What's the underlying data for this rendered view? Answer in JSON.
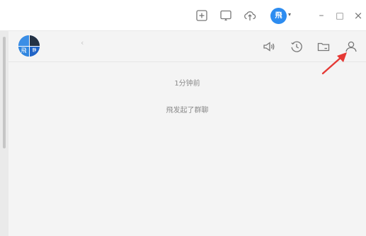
{
  "titlebar": {
    "icons": [
      "add-square-icon",
      "screen-share-icon",
      "cloud-upload-icon"
    ],
    "user_avatar_text": "飛",
    "caret": "▾",
    "minimize": "–",
    "maximize": "□",
    "close": "×"
  },
  "chat_header": {
    "group_avatar_text_a": "飛",
    "group_avatar_text_b": "静",
    "back_mark": "‹",
    "icons": [
      "speaker-icon",
      "history-clock-icon",
      "folder-icon",
      "members-icon"
    ]
  },
  "messages": {
    "time": "1分钟前",
    "system_text": "飛发起了群聊"
  },
  "colors": {
    "accent": "#2d8cf0",
    "annotation": "#e53935"
  }
}
